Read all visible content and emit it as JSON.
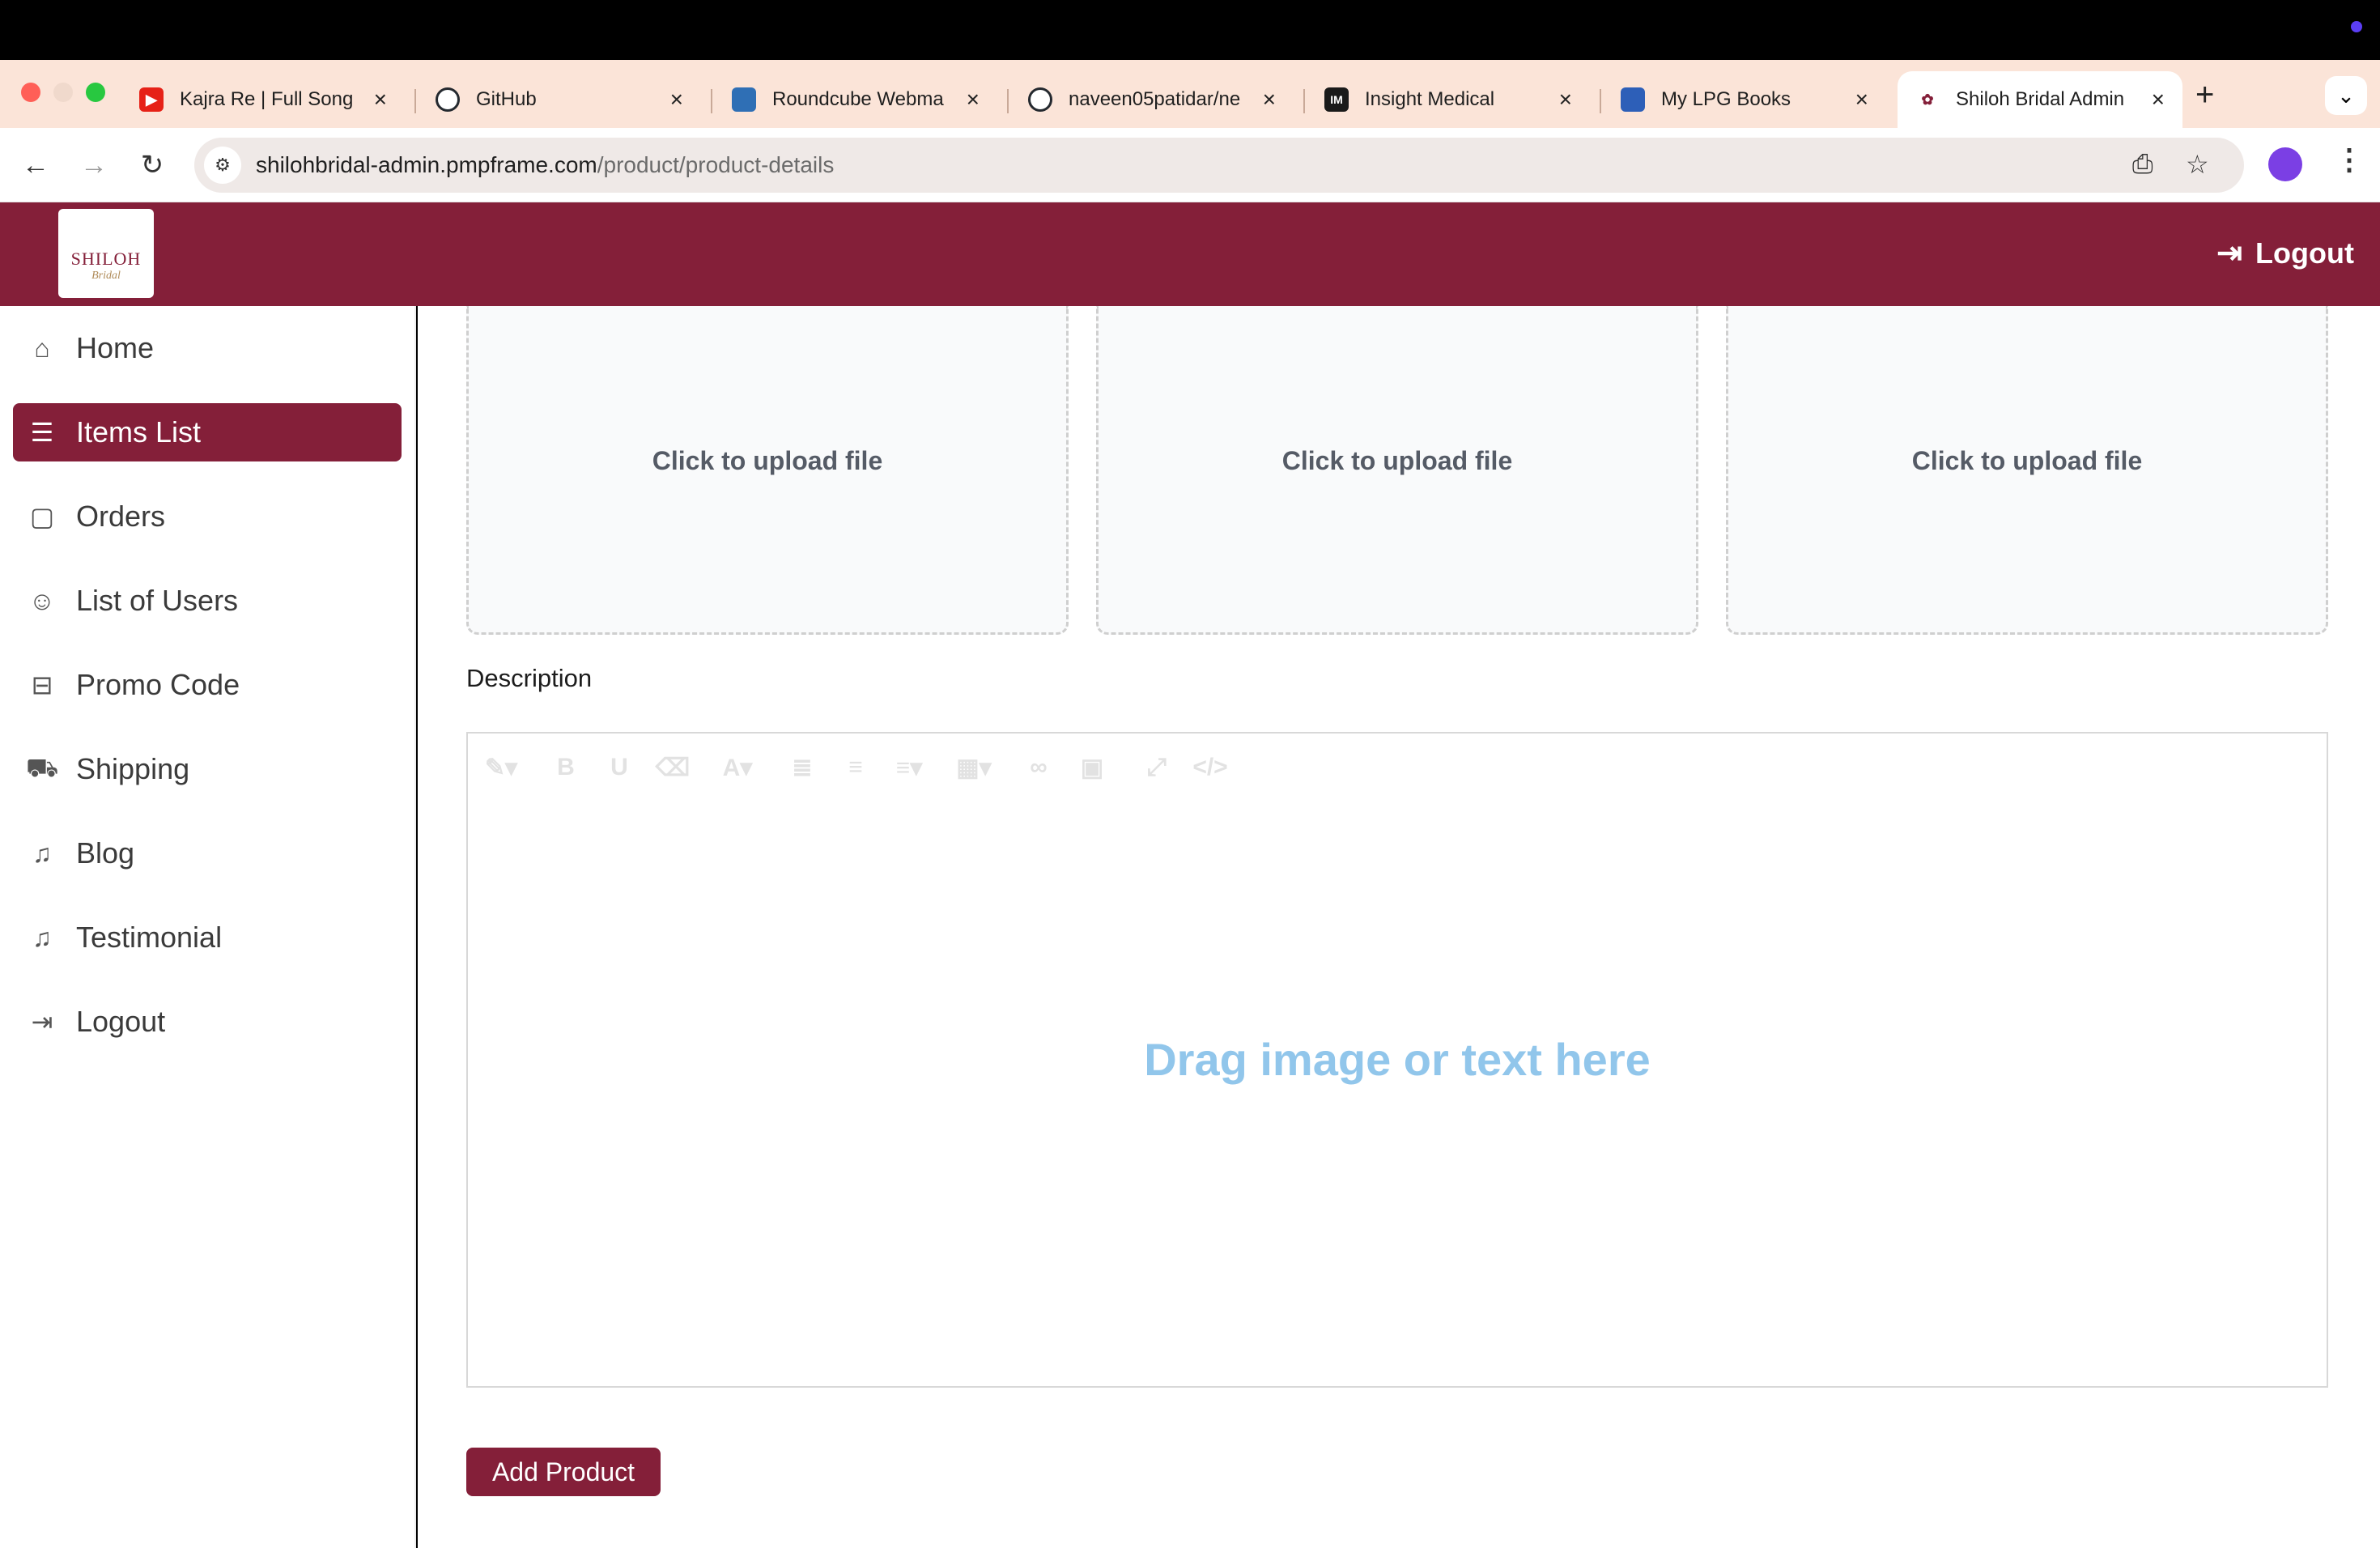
{
  "browser": {
    "tabs": [
      {
        "title": "Kajra Re | Full Song",
        "icon": "youtube-icon",
        "color": "#e62117"
      },
      {
        "title": "GitHub",
        "icon": "github-icon",
        "color": "#24292f"
      },
      {
        "title": "Roundcube Webma",
        "icon": "roundcube-icon",
        "color": "#2f6fb5"
      },
      {
        "title": "naveen05patidar/ne",
        "icon": "github-icon",
        "color": "#24292f"
      },
      {
        "title": "Insight Medical",
        "icon": "insight-icon",
        "color": "#1a1a1a"
      },
      {
        "title": "My LPG Books",
        "icon": "lpg-icon",
        "color": "#2d5fb8"
      },
      {
        "title": "Shiloh Bridal Admin",
        "icon": "shiloh-icon",
        "color": "#ffffff"
      }
    ],
    "url_host": "shilohbridal-admin.pmpframe.com",
    "url_path": "/product/product-details"
  },
  "header": {
    "logo_text": "SHILOH",
    "logo_sub": "Bridal",
    "logout_label": "Logout"
  },
  "sidebar": {
    "items": [
      {
        "label": "Home",
        "icon": "home-icon"
      },
      {
        "label": "Items List",
        "icon": "checklist-icon"
      },
      {
        "label": "Orders",
        "icon": "bag-icon"
      },
      {
        "label": "List of Users",
        "icon": "users-icon"
      },
      {
        "label": "Promo Code",
        "icon": "ticket-icon"
      },
      {
        "label": "Shipping",
        "icon": "truck-icon"
      },
      {
        "label": "Blog",
        "icon": "bell-icon"
      },
      {
        "label": "Testimonial",
        "icon": "bell-icon"
      },
      {
        "label": "Logout",
        "icon": "logout-icon"
      }
    ],
    "active_index": 1
  },
  "main": {
    "upload_label": "Click to upload file",
    "description_label": "Description",
    "editor_hint": "Drag image or text here",
    "add_button": "Add Product"
  },
  "colors": {
    "brand": "#841f39",
    "hint": "#91c6eb"
  }
}
